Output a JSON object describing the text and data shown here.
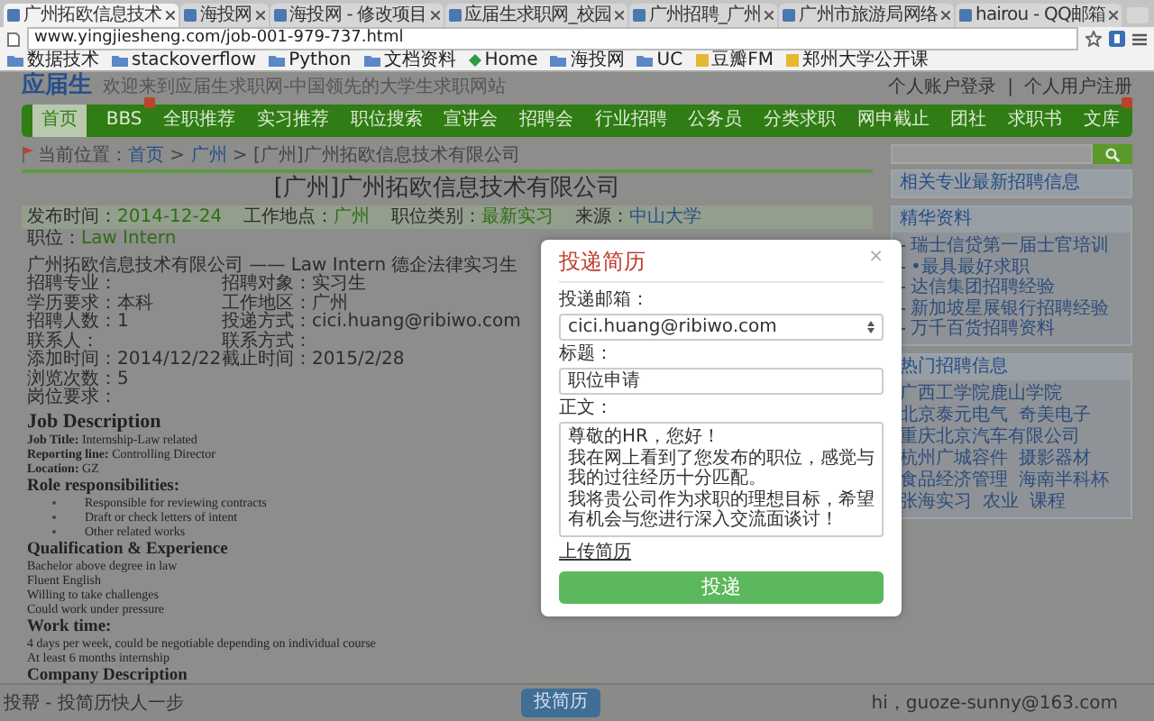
{
  "browser": {
    "tabs": [
      {
        "title": "广州拓欧信息技术",
        "selected": true
      },
      {
        "title": "海投网",
        "selected": false
      },
      {
        "title": "海投网 - 修改项目",
        "selected": false
      },
      {
        "title": "应届生求职网_校园",
        "selected": false
      },
      {
        "title": "广州招聘_广州",
        "selected": false
      },
      {
        "title": "广州市旅游局网络",
        "selected": false
      },
      {
        "title": "hairou - QQ邮箱",
        "selected": false
      }
    ],
    "address": "www.yingjiesheng.com/job-001-979-737.html",
    "bookmarks": [
      {
        "label": "数据技术",
        "kind": "folder"
      },
      {
        "label": "stackoverflow",
        "kind": "folder"
      },
      {
        "label": "Python",
        "kind": "folder"
      },
      {
        "label": "文档资料",
        "kind": "folder"
      },
      {
        "label": "Home",
        "kind": "site"
      },
      {
        "label": "海投网",
        "kind": "folder"
      },
      {
        "label": "UC",
        "kind": "folder"
      },
      {
        "label": "豆瓣FM",
        "kind": "page"
      },
      {
        "label": "郑州大学公开课",
        "kind": "page"
      }
    ]
  },
  "header": {
    "logo": "应届生",
    "tagline": "欢迎来到应届生求职网-中国领先的大学生求职网站",
    "account_links": [
      "个人账户登录",
      "个人用户注册"
    ],
    "account_separator": "|"
  },
  "nav": {
    "items": [
      {
        "label": "首页",
        "selected": true,
        "hot": false
      },
      {
        "label": "BBS",
        "selected": false,
        "hot": true
      },
      {
        "label": "全职推荐",
        "selected": false,
        "hot": false
      },
      {
        "label": "实习推荐",
        "selected": false,
        "hot": false
      },
      {
        "label": "职位搜索",
        "selected": false,
        "hot": false
      },
      {
        "label": "宣讲会",
        "selected": false,
        "hot": false
      },
      {
        "label": "招聘会",
        "selected": false,
        "hot": false
      },
      {
        "label": "行业招聘",
        "selected": false,
        "hot": false
      },
      {
        "label": "公务员",
        "selected": false,
        "hot": false
      },
      {
        "label": "分类求职",
        "selected": false,
        "hot": false
      },
      {
        "label": "网申截止",
        "selected": false,
        "hot": false
      },
      {
        "label": "团社",
        "selected": false,
        "hot": false
      },
      {
        "label": "求职书",
        "selected": false,
        "hot": false
      },
      {
        "label": "文库",
        "selected": false,
        "hot": true
      }
    ]
  },
  "breadcrumb": {
    "prefix": "当前位置：",
    "links": [
      "首页",
      "广州"
    ],
    "separator": " > ",
    "current": "[广州]广州拓欧信息技术有限公司"
  },
  "job": {
    "title": "[广州]广州拓欧信息技术有限公司",
    "meta": [
      {
        "label": "发布时间：",
        "value": "2014-12-24",
        "kind": "text"
      },
      {
        "label": "工作地点：",
        "value": "广州",
        "kind": "text"
      },
      {
        "label": "职位类别：",
        "value": "最新实习",
        "kind": "text"
      },
      {
        "label": "来源：",
        "value": "中山大学",
        "kind": "link"
      }
    ],
    "position": {
      "label": "职位：",
      "value": "Law Intern"
    },
    "summary": "广州拓欧信息技术有限公司 —— Law Intern 德企法律实习生",
    "fields": [
      [
        "招聘专业：",
        "招聘对象：实习生"
      ],
      [
        "学历要求：本科",
        "工作地区：广州"
      ],
      [
        "招聘人数：1",
        "投递方式：cici.huang@ribiwo.com"
      ],
      [
        "联系人：",
        "联系方式："
      ],
      [
        "添加时间：2014/12/22",
        "截止时间：2015/2/28"
      ],
      [
        "浏览次数：5"
      ],
      [
        "岗位要求："
      ]
    ],
    "description": [
      {
        "kind": "h1",
        "text": "Job Description"
      },
      {
        "kind": "line",
        "text": "**Job Title:** Internship-Law related"
      },
      {
        "kind": "line",
        "text": "**Reporting line:** Controlling Director"
      },
      {
        "kind": "line",
        "text": "**Location:** GZ"
      },
      {
        "kind": "h2",
        "text": "Role responsibilities:"
      },
      {
        "kind": "bullet",
        "text": "Responsible for reviewing contracts"
      },
      {
        "kind": "bullet",
        "text": "Draft or check letters of intent"
      },
      {
        "kind": "bullet",
        "text": "Other related works"
      },
      {
        "kind": "h2",
        "text": "Qualification & Experience"
      },
      {
        "kind": "line",
        "text": "Bachelor above degree in law"
      },
      {
        "kind": "line",
        "text": "Fluent English"
      },
      {
        "kind": "line",
        "text": "Willing to take challenges"
      },
      {
        "kind": "line",
        "text": "Could work under pressure"
      },
      {
        "kind": "h2",
        "text": "Work time:"
      },
      {
        "kind": "line",
        "text": "4 days per week, could be negotiable depending on individual course"
      },
      {
        "kind": "line",
        "text": "At least 6 months internship"
      },
      {
        "kind": "h2",
        "text": "Company Description"
      }
    ]
  },
  "sidebar": {
    "boxes": [
      {
        "title": "相关专业最新招聘信息"
      },
      {
        "title": "精华资料",
        "items": [
          "瑞士信贷第一届士官培训",
          "•最具最好求职",
          "达信集团招聘经验",
          "新加坡星展银行招聘经验",
          "万千百货招聘资料"
        ]
      },
      {
        "title": "热门招聘信息",
        "tags": [
          "广西工学院鹿山学院",
          "北京泰元电气",
          "奇美电子",
          "重庆北京汽车有限公司",
          "杭州广城容件",
          "摄影器材",
          "食品经济管理",
          "海南半科杯",
          "张海实习",
          "农业",
          "课程"
        ]
      }
    ]
  },
  "modal": {
    "title": "投递简历",
    "close": "×",
    "email_label": "投递邮箱：",
    "email": "cici.huang@ribiwo.com",
    "subject_label": "标题：",
    "subject": "职位申请",
    "body_label": "正文：",
    "body": [
      "尊敬的HR，您好！",
      "我在网上看到了您发布的职位，感觉与我的过往经历十分匹配。",
      "我将贵公司作为求职的理想目标，希望有机会与您进行深入交流面谈讨！"
    ],
    "upload": "上传简历",
    "submit": "投递"
  },
  "footer": {
    "slogan": "投帮 - 投简历快人一步",
    "button": "投简历",
    "user": "hi，guoze-sunny@163.com"
  }
}
